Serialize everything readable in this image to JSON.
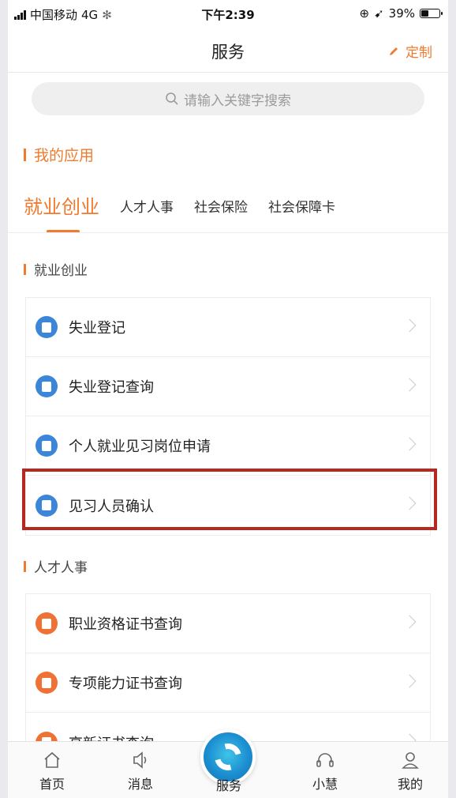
{
  "status": {
    "carrier": "中国移动",
    "network": "4G",
    "time": "下午2:39",
    "battery": "39%"
  },
  "nav": {
    "title": "服务",
    "action_label": "定制"
  },
  "search": {
    "placeholder": "请输入关键字搜索"
  },
  "my_apps": {
    "title": "我的应用"
  },
  "tabs": [
    {
      "label": "就业创业",
      "active": true
    },
    {
      "label": "人才人事",
      "active": false
    },
    {
      "label": "社会保险",
      "active": false
    },
    {
      "label": "社会保障卡",
      "active": false
    }
  ],
  "groups": [
    {
      "title": "就业创业",
      "items": [
        {
          "label": "失业登记",
          "icon": "person-badge-icon",
          "color": "#3b86d8"
        },
        {
          "label": "失业登记查询",
          "icon": "search-person-icon",
          "color": "#3b86d8"
        },
        {
          "label": "个人就业见习岗位申请",
          "icon": "clipboard-icon",
          "color": "#3b86d8"
        },
        {
          "label": "见习人员确认",
          "icon": "user-check-icon",
          "color": "#3b86d8",
          "highlighted": true
        }
      ]
    },
    {
      "title": "人才人事",
      "items": [
        {
          "label": "职业资格证书查询",
          "icon": "certificate-icon",
          "color": "#ef7133"
        },
        {
          "label": "专项能力证书查询",
          "icon": "certificate-icon",
          "color": "#ef7133"
        },
        {
          "label": "高新证书查询",
          "icon": "certificate-icon",
          "color": "#ef7133"
        }
      ]
    }
  ],
  "tabbar": [
    {
      "label": "首页",
      "icon": "home-icon"
    },
    {
      "label": "消息",
      "icon": "speaker-icon"
    },
    {
      "label": "服务",
      "icon": "service-logo-icon"
    },
    {
      "label": "小慧",
      "icon": "headset-icon"
    },
    {
      "label": "我的",
      "icon": "user-icon"
    }
  ],
  "colors": {
    "accent": "#f07a2e",
    "blue": "#3b86d8",
    "highlight": "#b5271f"
  }
}
